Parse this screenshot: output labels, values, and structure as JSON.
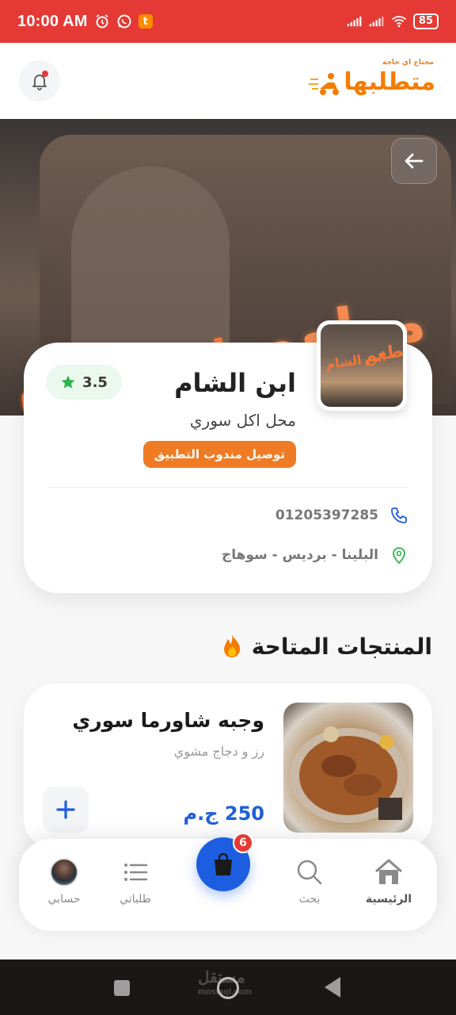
{
  "status_bar": {
    "time": "10:00 AM",
    "battery": "85",
    "notify_badge": "t"
  },
  "header": {
    "logo_tagline": "محتاج اي حاجة",
    "logo_text": "متطلبها",
    "logo_icon": "delivery-scooter-icon",
    "bell_icon": "bell-icon"
  },
  "hero": {
    "sign_left": "ابن الشام",
    "sign_right": "مطعم",
    "back_icon": "arrow-left-icon"
  },
  "store": {
    "name": "ابن الشام",
    "category": "محل اكل سوري",
    "delivery_badge": "توصيل مندوب التطبيق",
    "rating": "3.5",
    "phone": "01205397285",
    "address": "البلينا - برديس - سوهاج",
    "colors": {
      "badge": "#ef7b25",
      "rating_bg": "#eaf8ee",
      "rating_star": "#2db34a"
    }
  },
  "section": {
    "title": "المنتجات المتاحة",
    "icon": "fire-icon"
  },
  "products": [
    {
      "name": "وجبه شاورما سوري",
      "description": "رز و دجاج مشوي",
      "price": "250 ج.م"
    }
  ],
  "bottom_nav": {
    "items": [
      {
        "label": "الرئيسية",
        "icon": "home-icon",
        "active": true
      },
      {
        "label": "بحث",
        "icon": "search-icon",
        "active": false
      },
      {
        "label": "طلباتي",
        "icon": "list-icon",
        "active": false
      },
      {
        "label": "حسابي",
        "icon": "avatar",
        "active": false
      }
    ],
    "cart_count": "6",
    "accent": "#1d5ee0"
  },
  "system_nav": {
    "watermark": "مستقل",
    "watermark_sub": "mostaql.com"
  }
}
